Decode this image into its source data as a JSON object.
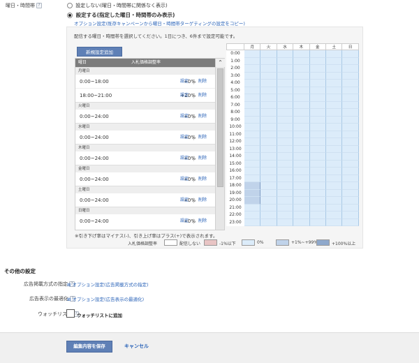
{
  "day_time": {
    "label": "曜日・時間帯",
    "opt_none": "設定しない(曜日・時間帯に関係なく表示)",
    "opt_set": "設定する(指定した曜日・時間帯のみ表示)",
    "copy_link": "オプション設定(既存キャンペーンから曜日・時間帯ターゲティングの設定をコピー)",
    "instruction": "配信する曜日・時間帯を選択してください。1日につき、6件まで設定可能です。",
    "add_button": "新規設定追加",
    "col_day": "曜日",
    "col_rate": "入札価格調整率",
    "action_set": "設定",
    "action_sep": "|",
    "action_delete": "削除",
    "days": [
      {
        "name": "月曜日",
        "rows": [
          {
            "time": "0:00~18:00",
            "rate": "+0%"
          },
          {
            "time": "18:00~21:00",
            "rate": "+20%"
          }
        ]
      },
      {
        "name": "火曜日",
        "rows": [
          {
            "time": "0:00~24:00",
            "rate": "+0%"
          }
        ]
      },
      {
        "name": "水曜日",
        "rows": [
          {
            "time": "0:00~24:00",
            "rate": "+0%"
          }
        ]
      },
      {
        "name": "木曜日",
        "rows": [
          {
            "time": "0:00~24:00",
            "rate": "+0%"
          }
        ]
      },
      {
        "name": "金曜日",
        "rows": [
          {
            "time": "0:00~24:00",
            "rate": "+0%"
          }
        ]
      },
      {
        "name": "土曜日",
        "rows": [
          {
            "time": "0:00~24:00",
            "rate": "+0%"
          }
        ]
      },
      {
        "name": "日曜日",
        "rows": [
          {
            "time": "0:00~24:00",
            "rate": "+0%"
          }
        ]
      }
    ],
    "grid_days": [
      "月",
      "火",
      "水",
      "木",
      "金",
      "土",
      "日"
    ],
    "grid_hours": [
      "0:00",
      "1:00",
      "2:00",
      "3:00",
      "4:00",
      "5:00",
      "6:00",
      "7:00",
      "8:00",
      "9:00",
      "10:00",
      "11:00",
      "12:00",
      "13:00",
      "14:00",
      "15:00",
      "16:00",
      "17:00",
      "18:00",
      "19:00",
      "20:00",
      "21:00",
      "22:00",
      "23:00"
    ],
    "note": "※引き下げ率はマイナス(-)、引き上げ率はプラス(+)で表示されます。",
    "legend": {
      "title": "入札価格調整率",
      "items": [
        "配信しない",
        "-1%以下",
        "0%",
        "+1%~+99%",
        "+100%以上"
      ],
      "colors": [
        "#ffffff",
        "#e8c4c4",
        "#dcecfa",
        "#c0d3ea",
        "#8fa9cc"
      ]
    }
  },
  "other": {
    "heading": "その他の設定",
    "ad_delivery_label": "広告掲載方式の指定",
    "ad_delivery_link": "オプション設定(広告掲載方式の指定)",
    "ad_opt_label": "広告表示の最適化",
    "ad_opt_link": "オプション設定(広告表示の最適化)",
    "watchlist_label": "ウォッチリスト",
    "watchlist_check": "ウォッチリストに追加"
  },
  "footer": {
    "save": "編集内容を保存",
    "cancel": "キャンセル"
  },
  "colors": {
    "accent": "#5f80b6",
    "link": "#2a63b8",
    "grid_on": "#dcecfa",
    "grid_boost": "#c0d3ea"
  }
}
